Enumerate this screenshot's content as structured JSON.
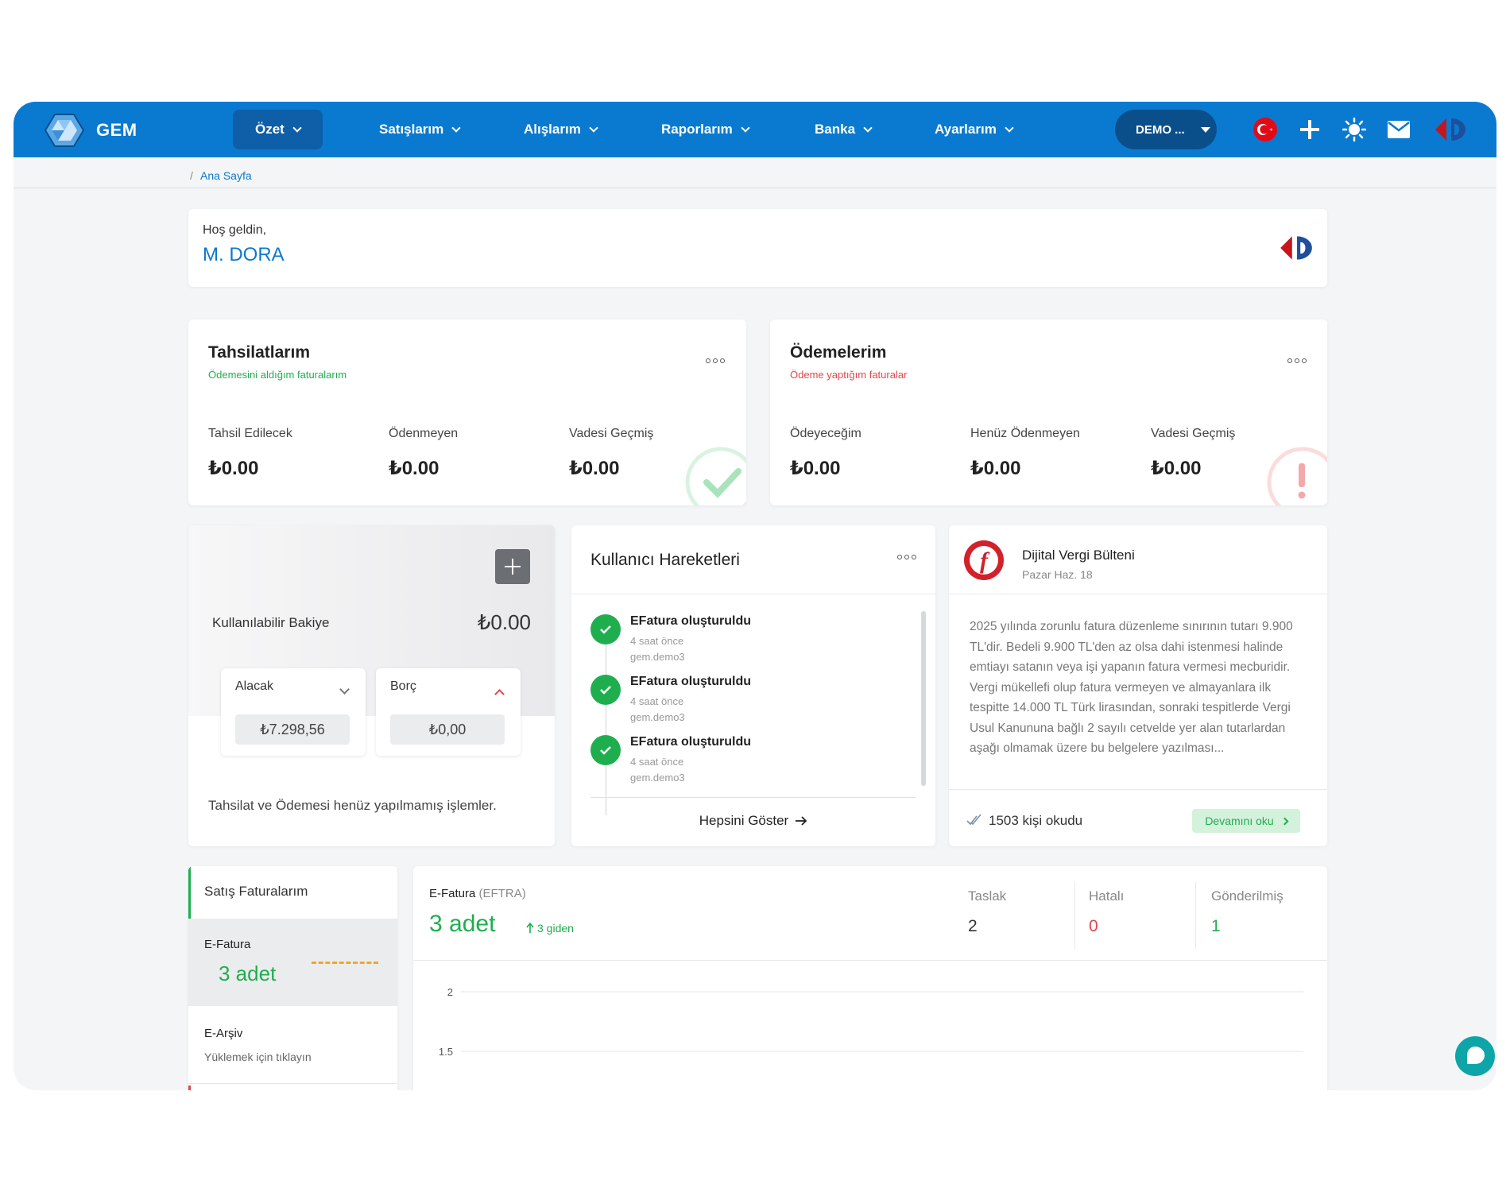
{
  "brand": {
    "name": "GEM"
  },
  "nav": {
    "items": [
      {
        "label": "Özet",
        "active": true
      },
      {
        "label": "Satışlarım"
      },
      {
        "label": "Alışlarım"
      },
      {
        "label": "Raporlarım"
      },
      {
        "label": "Banka"
      },
      {
        "label": "Ayarlarım"
      }
    ],
    "company_selector": "DEMO ...",
    "icons": [
      "turkey-flag-icon",
      "plus-icon",
      "sun-icon",
      "mail-icon",
      "carrefour-logo-icon"
    ]
  },
  "breadcrumb": {
    "sep": "/",
    "current": "Ana Sayfa"
  },
  "welcome": {
    "greeting": "Hoş geldin,",
    "name": "M. DORA"
  },
  "tahsilat": {
    "title": "Tahsilatlarım",
    "subtitle": "Ödemesini aldığım faturalarım",
    "subtitle_color": "#1fae4e",
    "stats": [
      {
        "label": "Tahsil Edilecek",
        "value": "₺0.00"
      },
      {
        "label": "Ödenmeyen",
        "value": "₺0.00"
      },
      {
        "label": "Vadesi Geçmiş",
        "value": "₺0.00"
      }
    ]
  },
  "odeme": {
    "title": "Ödemelerim",
    "subtitle": "Ödeme yaptığım faturalar",
    "subtitle_color": "#e0474c",
    "stats": [
      {
        "label": "Ödeyeceğim",
        "value": "₺0.00"
      },
      {
        "label": "Henüz Ödenmeyen",
        "value": "₺0.00"
      },
      {
        "label": "Vadesi Geçmiş",
        "value": "₺0.00"
      }
    ]
  },
  "bakiye": {
    "label": "Kullanılabilir Bakiye",
    "value": "₺0.00",
    "alacak": {
      "label": "Alacak",
      "value": "₺7.298,56"
    },
    "borc": {
      "label": "Borç",
      "value": "₺0,00"
    },
    "footer": "Tahsilat ve Ödemesi henüz yapılmamış işlemler."
  },
  "activity": {
    "title": "Kullanıcı Hareketleri",
    "items": [
      {
        "title": "EFatura oluşturuldu",
        "time": "4 saat önce",
        "user": "gem.demo3"
      },
      {
        "title": "EFatura oluşturuldu",
        "time": "4 saat önce",
        "user": "gem.demo3"
      },
      {
        "title": "EFatura oluşturuldu",
        "time": "4 saat önce",
        "user": "gem.demo3"
      }
    ],
    "show_all": "Hepsini Göster"
  },
  "news": {
    "title": "Dijital Vergi Bülteni",
    "date": "Pazar Haz. 18",
    "body": "2025 yılında zorunlu fatura düzenleme sınırının tutarı 9.900 TL'dir. Bedeli 9.900 TL'den az olsa dahi istenmesi halinde emtiayı satanın veya işi yapanın fatura vermesi mecburidir. Vergi mükellefi olup fatura vermeyen ve almayanlara ilk tespitte 14.000 TL Türk lirasından, sonraki tespitlerde Vergi Usul Kanununa bağlı 2 sayılı cetvelde yer alan tutarlardan aşağı olmamak üzere bu belgelere yazılması...",
    "read_count": "1503 kişi okudu",
    "read_more": "Devamını oku"
  },
  "invoices": {
    "sidebar_title": "Satış Faturalarım",
    "tabs": [
      {
        "label": "E-Fatura",
        "value": "3 adet"
      },
      {
        "label": "E-Arşiv",
        "sub": "Yüklemek için tıklayın"
      }
    ],
    "main": {
      "title": "E-Fatura",
      "tag": "(EFTRA)",
      "count": "3 adet",
      "trend": "3 giden",
      "stats": [
        {
          "label": "Taslak",
          "value": "2",
          "color": "#333333"
        },
        {
          "label": "Hatalı",
          "value": "0",
          "color": "#e0474c"
        },
        {
          "label": "Gönderilmiş",
          "value": "1",
          "color": "#1fae4e"
        }
      ]
    }
  },
  "chart_data": {
    "type": "line",
    "y_ticks": [
      "2",
      "1.5"
    ],
    "ylim": [
      1.5,
      2
    ],
    "grid": true
  },
  "colors": {
    "brand": "#0a7ad0",
    "success": "#1fae4e",
    "danger": "#e0474c"
  }
}
